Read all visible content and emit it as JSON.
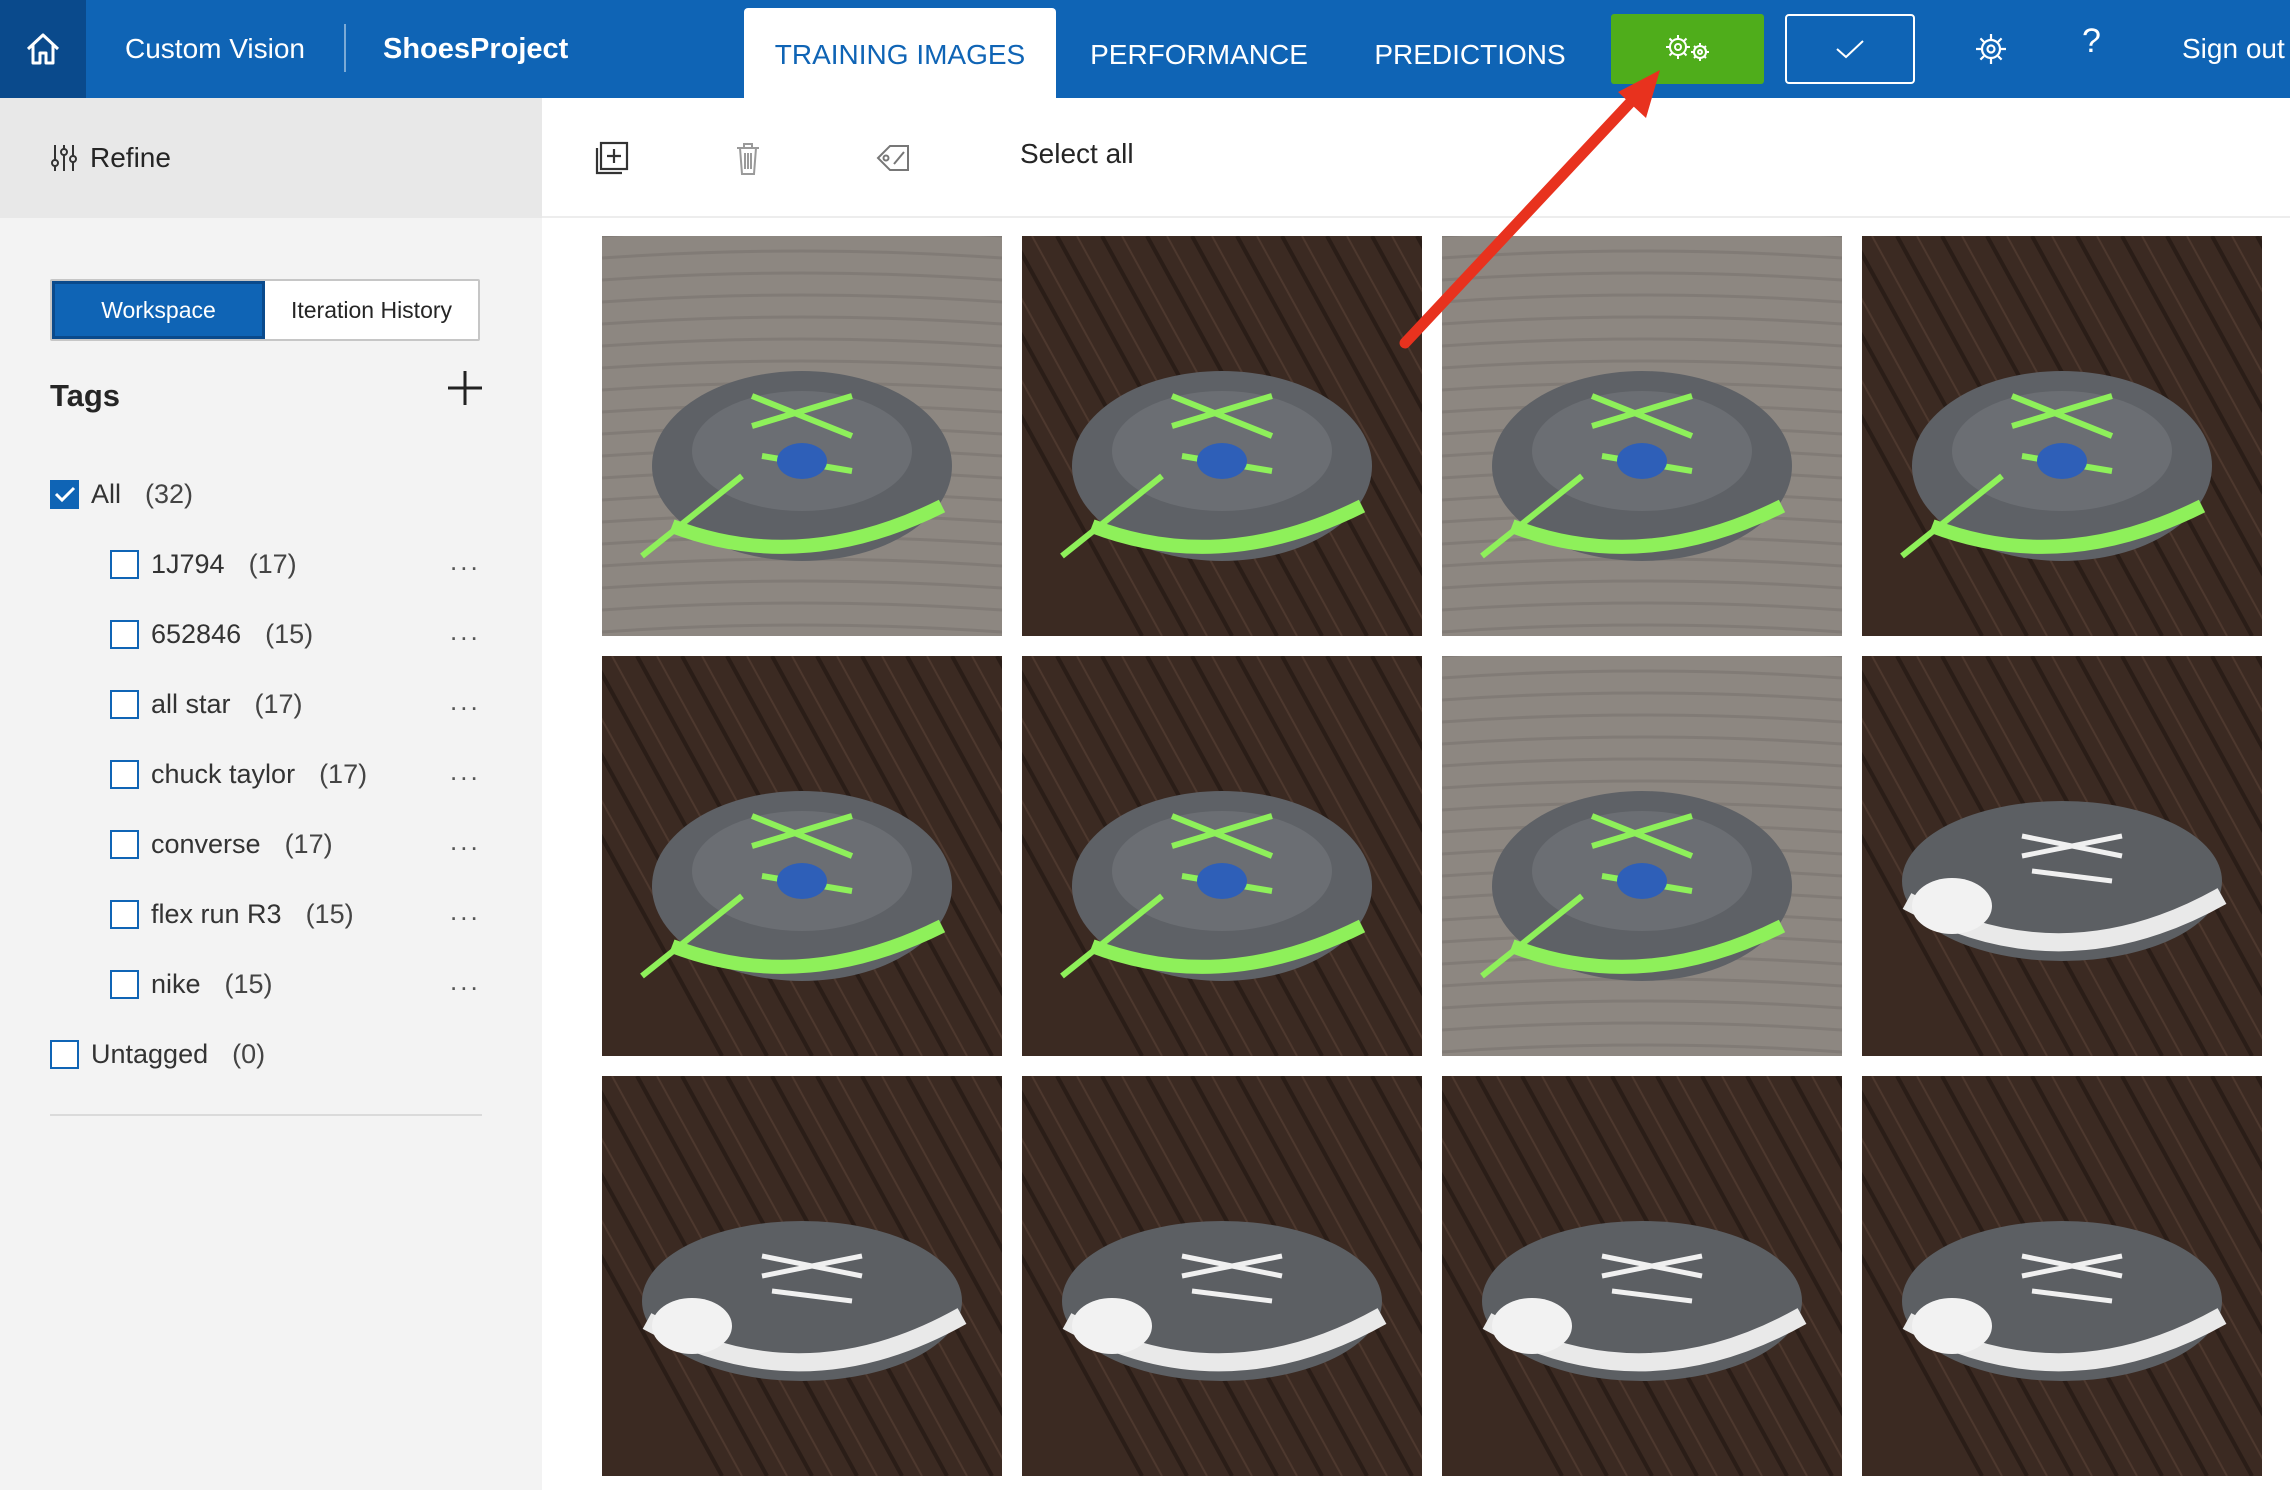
{
  "header": {
    "brand": "Custom Vision",
    "project": "ShoesProject",
    "tabs": [
      {
        "label": "TRAINING IMAGES",
        "active": true
      },
      {
        "label": "PERFORMANCE",
        "active": false
      },
      {
        "label": "PREDICTIONS",
        "active": false
      }
    ],
    "train_button_icon": "gears-icon",
    "quick_test_icon": "check-icon",
    "help_label": "?",
    "sign_out": "Sign out"
  },
  "toolbar": {
    "refine": "Refine",
    "select_all": "Select all"
  },
  "sidebar": {
    "workspace_tab": "Workspace",
    "history_tab": "Iteration History",
    "tags_title": "Tags",
    "all": {
      "name": "All",
      "count": "(32)",
      "checked": true
    },
    "tags": [
      {
        "name": "1J794",
        "count": "(17)"
      },
      {
        "name": "652846",
        "count": "(15)"
      },
      {
        "name": "all star",
        "count": "(17)"
      },
      {
        "name": "chuck taylor",
        "count": "(17)"
      },
      {
        "name": "converse",
        "count": "(17)"
      },
      {
        "name": "flex run R3",
        "count": "(15)"
      },
      {
        "name": "nike",
        "count": "(15)"
      }
    ],
    "untagged": {
      "name": "Untagged",
      "count": "(0)"
    },
    "more_label": "..."
  },
  "images": [
    {
      "floor": "carpet",
      "shoe": "nike"
    },
    {
      "floor": "wood",
      "shoe": "nike"
    },
    {
      "floor": "carpet",
      "shoe": "nike"
    },
    {
      "floor": "wood",
      "shoe": "nike"
    },
    {
      "floor": "wood",
      "shoe": "nike"
    },
    {
      "floor": "wood",
      "shoe": "nike"
    },
    {
      "floor": "carpet",
      "shoe": "nike"
    },
    {
      "floor": "wood",
      "shoe": "converse"
    },
    {
      "floor": "wood",
      "shoe": "converse"
    },
    {
      "floor": "wood",
      "shoe": "converse"
    },
    {
      "floor": "wood",
      "shoe": "converse"
    },
    {
      "floor": "wood",
      "shoe": "converse"
    }
  ],
  "colors": {
    "header": "#0f64b5",
    "train_button": "#4fad1b",
    "arrow": "#e8321e",
    "lace_green": "#8ef05a",
    "shoe_gray": "#5e6166"
  }
}
